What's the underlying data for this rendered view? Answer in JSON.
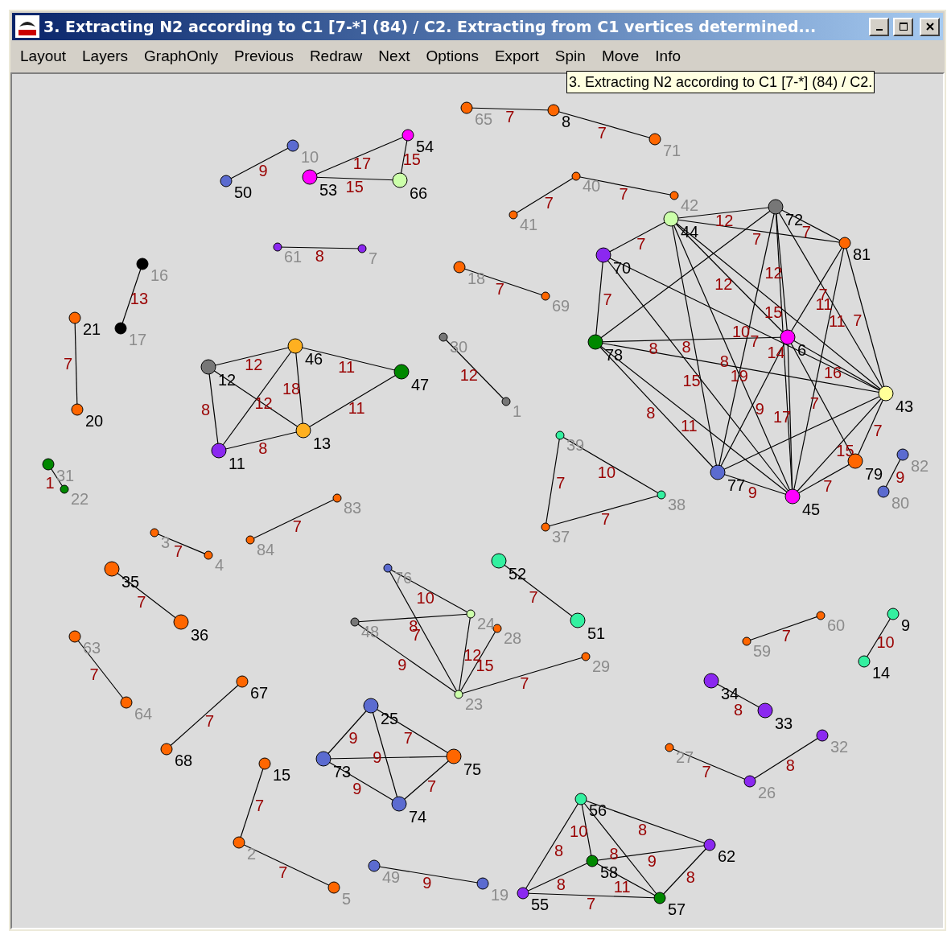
{
  "window": {
    "title": "3. Extracting N2 according to C1 [7-*] (84) / C2. Extracting from C1 vertices determined..."
  },
  "menu": [
    {
      "label": "Layout"
    },
    {
      "label": "Layers"
    },
    {
      "label": "GraphOnly"
    },
    {
      "label": "Previous"
    },
    {
      "label": "Redraw"
    },
    {
      "label": "Next"
    },
    {
      "label": "Options"
    },
    {
      "label": "Export"
    },
    {
      "label": "Spin"
    },
    {
      "label": "Move"
    },
    {
      "label": "Info"
    }
  ],
  "tooltip": "3. Extracting N2 according to C1 [7-*] (84) / C2.",
  "graph": {
    "nodes": [
      {
        "label": "65",
        "color": "#ff6600",
        "dimmed": true,
        "kind": "medium"
      },
      {
        "label": "8",
        "color": "#ff6600",
        "dimmed": false,
        "kind": "medium"
      },
      {
        "label": "71",
        "color": "#ff6600",
        "dimmed": true,
        "kind": "medium"
      },
      {
        "label": "10",
        "color": "#5b6bd0",
        "dimmed": true,
        "kind": "medium"
      },
      {
        "label": "50",
        "color": "#5b6bd0",
        "dimmed": false,
        "kind": "medium"
      },
      {
        "label": "53",
        "color": "#ff00ff",
        "dimmed": false,
        "kind": "large"
      },
      {
        "label": "54",
        "color": "#ff00ff",
        "dimmed": false,
        "kind": "medium"
      },
      {
        "label": "66",
        "color": "#ccffaa",
        "dimmed": false,
        "kind": "large"
      },
      {
        "label": "40",
        "color": "#ff6600",
        "dimmed": true,
        "kind": "small"
      },
      {
        "label": "41",
        "color": "#ff6600",
        "dimmed": true,
        "kind": "small"
      },
      {
        "label": "42",
        "color": "#ff6600",
        "dimmed": true,
        "kind": "small"
      },
      {
        "label": "61",
        "color": "#8b28f0",
        "dimmed": true,
        "kind": "small"
      },
      {
        "label": "7",
        "color": "#8b28f0",
        "dimmed": true,
        "kind": "small"
      },
      {
        "label": "16",
        "color": "#000000",
        "dimmed": true,
        "kind": "medium"
      },
      {
        "label": "17",
        "color": "#000000",
        "dimmed": true,
        "kind": "medium"
      },
      {
        "label": "21",
        "color": "#ff6600",
        "dimmed": false,
        "kind": "medium"
      },
      {
        "label": "20",
        "color": "#ff6600",
        "dimmed": false,
        "kind": "medium"
      },
      {
        "label": "18",
        "color": "#ff6600",
        "dimmed": true,
        "kind": "medium"
      },
      {
        "label": "69",
        "color": "#ff6600",
        "dimmed": true,
        "kind": "small"
      },
      {
        "label": "30",
        "color": "#777777",
        "dimmed": true,
        "kind": "small"
      },
      {
        "label": "1",
        "color": "#777777",
        "dimmed": true,
        "kind": "small"
      },
      {
        "label": "12",
        "color": "#777777",
        "dimmed": false,
        "kind": "large"
      },
      {
        "label": "46",
        "color": "#ffb020",
        "dimmed": false,
        "kind": "large"
      },
      {
        "label": "47",
        "color": "#008800",
        "dimmed": false,
        "kind": "large"
      },
      {
        "label": "13",
        "color": "#ffb020",
        "dimmed": false,
        "kind": "large"
      },
      {
        "label": "11",
        "color": "#8b28f0",
        "dimmed": false,
        "kind": "large"
      },
      {
        "label": "31",
        "color": "#008800",
        "dimmed": true,
        "kind": "medium"
      },
      {
        "label": "22",
        "color": "#008800",
        "dimmed": true,
        "kind": "small"
      },
      {
        "label": "83",
        "color": "#ff6600",
        "dimmed": true,
        "kind": "small"
      },
      {
        "label": "84",
        "color": "#ff6600",
        "dimmed": true,
        "kind": "small"
      },
      {
        "label": "3",
        "color": "#ff6600",
        "dimmed": true,
        "kind": "small"
      },
      {
        "label": "4",
        "color": "#ff6600",
        "dimmed": true,
        "kind": "small"
      },
      {
        "label": "35",
        "color": "#ff6600",
        "dimmed": false,
        "kind": "large"
      },
      {
        "label": "36",
        "color": "#ff6600",
        "dimmed": false,
        "kind": "large"
      },
      {
        "label": "63",
        "color": "#ff6600",
        "dimmed": true,
        "kind": "medium"
      },
      {
        "label": "64",
        "color": "#ff6600",
        "dimmed": true,
        "kind": "medium"
      },
      {
        "label": "67",
        "color": "#ff6600",
        "dimmed": false,
        "kind": "medium"
      },
      {
        "label": "68",
        "color": "#ff6600",
        "dimmed": false,
        "kind": "medium"
      },
      {
        "label": "15",
        "color": "#ff6600",
        "dimmed": false,
        "kind": "medium"
      },
      {
        "label": "2",
        "color": "#ff6600",
        "dimmed": true,
        "kind": "medium"
      },
      {
        "label": "5",
        "color": "#ff6600",
        "dimmed": true,
        "kind": "medium"
      },
      {
        "label": "39",
        "color": "#33f0a0",
        "dimmed": true,
        "kind": "small"
      },
      {
        "label": "38",
        "color": "#33f0a0",
        "dimmed": true,
        "kind": "small"
      },
      {
        "label": "37",
        "color": "#ff6600",
        "dimmed": true,
        "kind": "small"
      },
      {
        "label": "52",
        "color": "#33f0a0",
        "dimmed": false,
        "kind": "large"
      },
      {
        "label": "51",
        "color": "#33f0a0",
        "dimmed": false,
        "kind": "large"
      },
      {
        "label": "76",
        "color": "#5b6bd0",
        "dimmed": true,
        "kind": "small"
      },
      {
        "label": "48",
        "color": "#777777",
        "dimmed": true,
        "kind": "small"
      },
      {
        "label": "24",
        "color": "#ccffaa",
        "dimmed": true,
        "kind": "small"
      },
      {
        "label": "28",
        "color": "#ff6600",
        "dimmed": true,
        "kind": "small"
      },
      {
        "label": "23",
        "color": "#ccffaa",
        "dimmed": true,
        "kind": "small"
      },
      {
        "label": "29",
        "color": "#ff6600",
        "dimmed": true,
        "kind": "small"
      },
      {
        "label": "25",
        "color": "#5b6bd0",
        "dimmed": false,
        "kind": "large"
      },
      {
        "label": "73",
        "color": "#5b6bd0",
        "dimmed": false,
        "kind": "large"
      },
      {
        "label": "75",
        "color": "#ff6600",
        "dimmed": false,
        "kind": "large"
      },
      {
        "label": "74",
        "color": "#5b6bd0",
        "dimmed": false,
        "kind": "large"
      },
      {
        "label": "49",
        "color": "#5b6bd0",
        "dimmed": true,
        "kind": "medium"
      },
      {
        "label": "19",
        "color": "#5b6bd0",
        "dimmed": true,
        "kind": "medium"
      },
      {
        "label": "56",
        "color": "#33f0a0",
        "dimmed": false,
        "kind": "medium"
      },
      {
        "label": "62",
        "color": "#8b28f0",
        "dimmed": false,
        "kind": "medium"
      },
      {
        "label": "58",
        "color": "#008800",
        "dimmed": false,
        "kind": "medium"
      },
      {
        "label": "55",
        "color": "#8b28f0",
        "dimmed": false,
        "kind": "medium"
      },
      {
        "label": "57",
        "color": "#008800",
        "dimmed": false,
        "kind": "medium"
      },
      {
        "label": "60",
        "color": "#ff6600",
        "dimmed": true,
        "kind": "small"
      },
      {
        "label": "59",
        "color": "#ff6600",
        "dimmed": true,
        "kind": "small"
      },
      {
        "label": "9",
        "color": "#33f0a0",
        "dimmed": false,
        "kind": "medium"
      },
      {
        "label": "14",
        "color": "#33f0a0",
        "dimmed": false,
        "kind": "medium"
      },
      {
        "label": "34",
        "color": "#8b28f0",
        "dimmed": false,
        "kind": "large"
      },
      {
        "label": "33",
        "color": "#8b28f0",
        "dimmed": false,
        "kind": "large"
      },
      {
        "label": "27",
        "color": "#ff6600",
        "dimmed": true,
        "kind": "small"
      },
      {
        "label": "26",
        "color": "#8b28f0",
        "dimmed": true,
        "kind": "medium"
      },
      {
        "label": "32",
        "color": "#8b28f0",
        "dimmed": true,
        "kind": "medium"
      },
      {
        "label": "82",
        "color": "#5b6bd0",
        "dimmed": true,
        "kind": "medium"
      },
      {
        "label": "80",
        "color": "#5b6bd0",
        "dimmed": true,
        "kind": "medium"
      },
      {
        "label": "44",
        "color": "#ccffaa",
        "dimmed": false,
        "kind": "large"
      },
      {
        "label": "72",
        "color": "#777777",
        "dimmed": false,
        "kind": "large"
      },
      {
        "label": "81",
        "color": "#ff6600",
        "dimmed": false,
        "kind": "medium"
      },
      {
        "label": "70",
        "color": "#8b28f0",
        "dimmed": false,
        "kind": "large"
      },
      {
        "label": "6",
        "color": "#ff00ff",
        "dimmed": false,
        "kind": "large"
      },
      {
        "label": "78",
        "color": "#008800",
        "dimmed": false,
        "kind": "large"
      },
      {
        "label": "43",
        "color": "#ffff99",
        "dimmed": false,
        "kind": "large"
      },
      {
        "label": "77",
        "color": "#5b6bd0",
        "dimmed": false,
        "kind": "large"
      },
      {
        "label": "79",
        "color": "#ff6600",
        "dimmed": false,
        "kind": "large"
      },
      {
        "label": "45",
        "color": "#ff00ff",
        "dimmed": false,
        "kind": "large"
      }
    ],
    "edges": [
      {
        "weight": "7"
      },
      {
        "weight": "7"
      },
      {
        "weight": "9"
      },
      {
        "weight": "17"
      },
      {
        "weight": "15"
      },
      {
        "weight": "15"
      },
      {
        "weight": "7"
      },
      {
        "weight": "7"
      },
      {
        "weight": "8"
      },
      {
        "weight": "13"
      },
      {
        "weight": "7"
      },
      {
        "weight": "7"
      },
      {
        "weight": "12"
      },
      {
        "weight": "12"
      },
      {
        "weight": "11"
      },
      {
        "weight": "8"
      },
      {
        "weight": "12"
      },
      {
        "weight": "18"
      },
      {
        "weight": "11"
      },
      {
        "weight": "8"
      },
      {
        "weight": "1"
      },
      {
        "weight": "7"
      },
      {
        "weight": "7"
      },
      {
        "weight": "7"
      },
      {
        "weight": "7"
      },
      {
        "weight": "7"
      },
      {
        "weight": "7"
      },
      {
        "weight": "7"
      },
      {
        "weight": "10"
      },
      {
        "weight": "7"
      },
      {
        "weight": "7"
      },
      {
        "weight": "10"
      },
      {
        "weight": "8"
      },
      {
        "weight": "7"
      },
      {
        "weight": "9"
      },
      {
        "weight": "12"
      },
      {
        "weight": "15"
      },
      {
        "weight": "7"
      },
      {
        "weight": "7"
      },
      {
        "weight": "9"
      },
      {
        "weight": "7"
      },
      {
        "weight": "9"
      },
      {
        "weight": "9"
      },
      {
        "weight": "7"
      },
      {
        "weight": "9"
      },
      {
        "weight": "8"
      },
      {
        "weight": "10"
      },
      {
        "weight": "8"
      },
      {
        "weight": "9"
      },
      {
        "weight": "8"
      },
      {
        "weight": "8"
      },
      {
        "weight": "11"
      },
      {
        "weight": "7"
      },
      {
        "weight": "8"
      },
      {
        "weight": "7"
      },
      {
        "weight": "10"
      },
      {
        "weight": "8"
      },
      {
        "weight": "7"
      },
      {
        "weight": "8"
      },
      {
        "weight": "9"
      },
      {
        "weight": "12"
      },
      {
        "weight": "7"
      },
      {
        "weight": "7"
      },
      {
        "weight": "7"
      },
      {
        "weight": "7"
      },
      {
        "weight": "10"
      },
      {
        "weight": "8"
      },
      {
        "weight": "8"
      },
      {
        "weight": "12"
      },
      {
        "weight": "15"
      },
      {
        "weight": "7"
      },
      {
        "weight": "7"
      },
      {
        "weight": "11"
      },
      {
        "weight": "7"
      },
      {
        "weight": "8"
      },
      {
        "weight": "19"
      },
      {
        "weight": "8"
      },
      {
        "weight": "11"
      },
      {
        "weight": "14"
      },
      {
        "weight": "17"
      },
      {
        "weight": "9"
      },
      {
        "weight": "7"
      },
      {
        "weight": "15"
      },
      {
        "weight": "7"
      },
      {
        "weight": "9"
      },
      {
        "weight": "7"
      },
      {
        "weight": "11"
      },
      {
        "weight": "15"
      },
      {
        "weight": "16"
      },
      {
        "weight": "12"
      }
    ]
  }
}
